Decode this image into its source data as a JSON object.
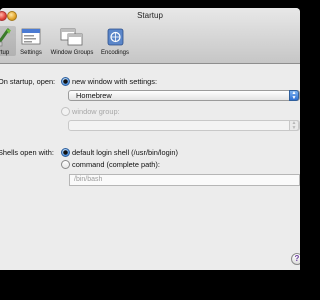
{
  "window": {
    "title": "Startup"
  },
  "toolbar": {
    "items": [
      {
        "label": "rtup",
        "icon": "startup-icon",
        "selected": true
      },
      {
        "label": "Settings",
        "icon": "settings-icon"
      },
      {
        "label": "Window Groups",
        "icon": "window-groups-icon"
      },
      {
        "label": "Encodings",
        "icon": "encodings-icon"
      }
    ]
  },
  "startup": {
    "label": "On startup, open:",
    "new_window_label": "new window with settings:",
    "settings_value": "Homebrew",
    "window_group_label": "window group:",
    "window_group_value": ""
  },
  "shell": {
    "label": "Shells open with:",
    "default_label": "default login shell (/usr/bin/login)",
    "command_label": "command (complete path):",
    "command_placeholder": "/bin/bash"
  },
  "help": {
    "glyph": "?"
  }
}
